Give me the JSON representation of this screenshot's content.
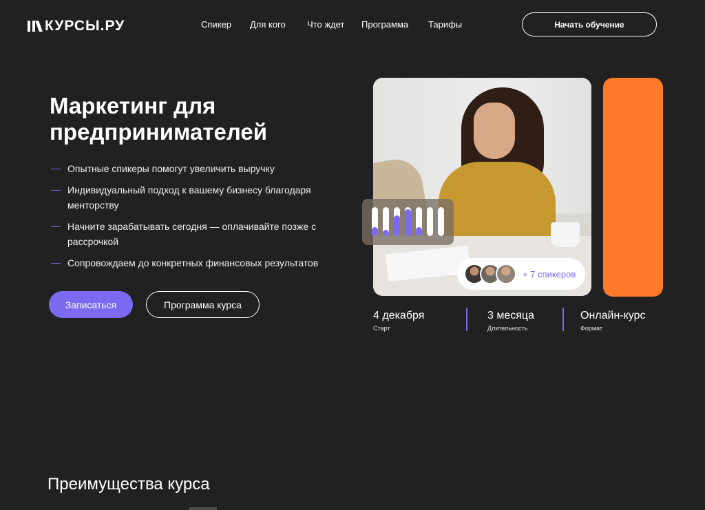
{
  "header": {
    "logo_text": "КУРСЫ.РУ",
    "nav": [
      "Спикер",
      "Для кого",
      "Что ждет",
      "Программа",
      "Тарифы"
    ],
    "cta_label": "Начать обучение"
  },
  "hero": {
    "title": "Маркетинг для предпринимателей",
    "features": [
      "Опытные спикеры помогут увеличить выручку",
      "Индивидуальный подход к вашему бизнесу благодаря менторству",
      "Начните зарабатывать сегодня — оплачивайте позже с рассрочкой",
      "Сопровождаем до конкретных финансовых результатов"
    ],
    "primary_button": "Записаться",
    "secondary_button": "Программа курса"
  },
  "media": {
    "bar_levels": [
      0.32,
      0.22,
      0.72,
      0.92,
      0.3,
      0,
      0
    ],
    "speakers_text": "+ 7 спикеров"
  },
  "stats": [
    {
      "value": "4 декабря",
      "label": "Старт"
    },
    {
      "value": "3 месяца",
      "label": "Длительность"
    },
    {
      "value": "Онлайн-курс",
      "label": "Формат"
    }
  ],
  "section": {
    "title": "Преимущества курса"
  },
  "colors": {
    "background": "#212121",
    "accent": "#7b6af0",
    "orange": "#ff7a2b"
  }
}
